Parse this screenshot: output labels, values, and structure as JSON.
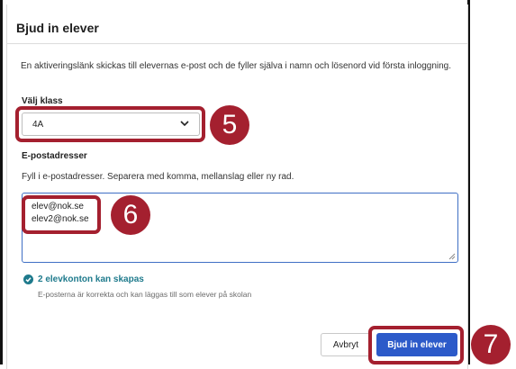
{
  "dialog": {
    "title": "Bjud in elever",
    "intro": "En aktiveringslänk skickas till elevernas e-post och de fyller själva i namn och lösenord vid första inloggning."
  },
  "class_select": {
    "label": "Välj klass",
    "value": "4A"
  },
  "emails": {
    "label": "E-postadresser",
    "hint": "Fyll i e-postadresser. Separera med komma, mellanslag eller ny rad.",
    "entries": [
      "elev@nok.se",
      "elev2@nok.se"
    ]
  },
  "status": {
    "title": "2 elevkonton kan skapas",
    "description": "E-posterna är korrekta och kan läggas till som elever på skolan",
    "color": "#1e7a8c"
  },
  "buttons": {
    "cancel": "Avbryt",
    "invite": "Bjud in elever"
  },
  "annotations": {
    "step_select": "5",
    "step_emails": "6",
    "step_invite": "7",
    "color": "#a4202f"
  },
  "theme": {
    "primary": "#2c5ac9"
  }
}
